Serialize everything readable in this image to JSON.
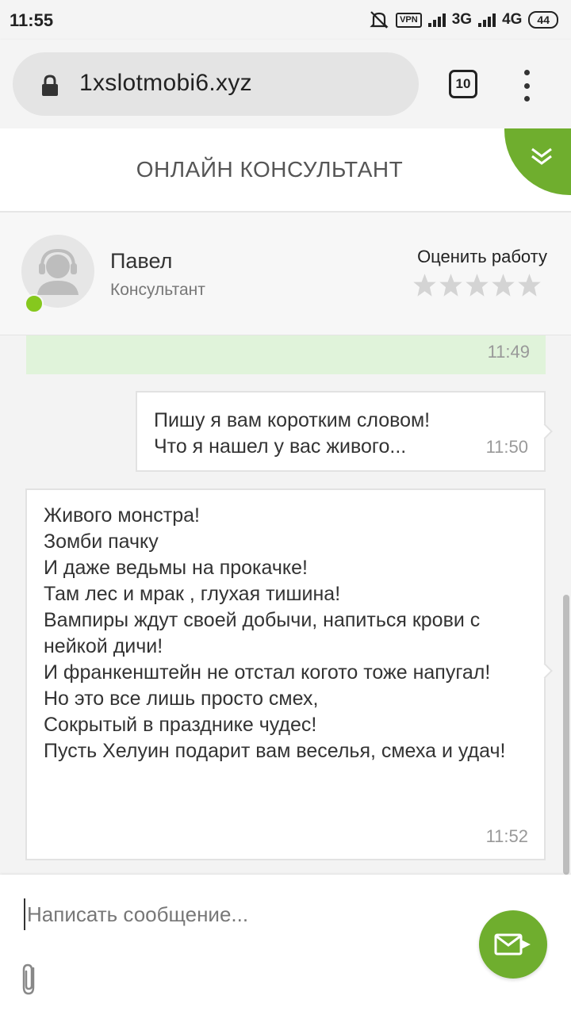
{
  "status_bar": {
    "time": "11:55",
    "vpn": "VPN",
    "network_1": "3G",
    "network_2": "4G",
    "battery": "44"
  },
  "browser": {
    "url": "1xslotmobi6.xyz",
    "tab_count": "10"
  },
  "chat": {
    "title": "ОНЛАЙН КОНСУЛЬТАНТ",
    "accent_color": "#6fae2e",
    "consultant": {
      "name": "Павел",
      "role": "Консультант",
      "status": "online"
    },
    "rating": {
      "label": "Оценить работу",
      "stars_total": 5,
      "stars_selected": 0
    },
    "messages": [
      {
        "time": "11:49"
      },
      {
        "text": "Пишу я вам коротким словом!\nЧто я нашел у вас живого...",
        "time": "11:50"
      },
      {
        "text": "Живого монстра!\nЗомби пачку\nИ даже ведьмы на прокачке!\nТам лес и мрак , глухая тишина!\nВампиры ждут своей добычи, напиться крови с нейкой дичи!\nИ франкенштейн не отстал когото тоже напугал!\nНо это все лишь просто смех,\nСокрытый в празднике чудес!\nПусть Хелуин подарит вам веселья, смеха и удач!",
        "time": "11:52"
      }
    ],
    "input": {
      "placeholder": "Написать сообщение...",
      "value": ""
    }
  }
}
